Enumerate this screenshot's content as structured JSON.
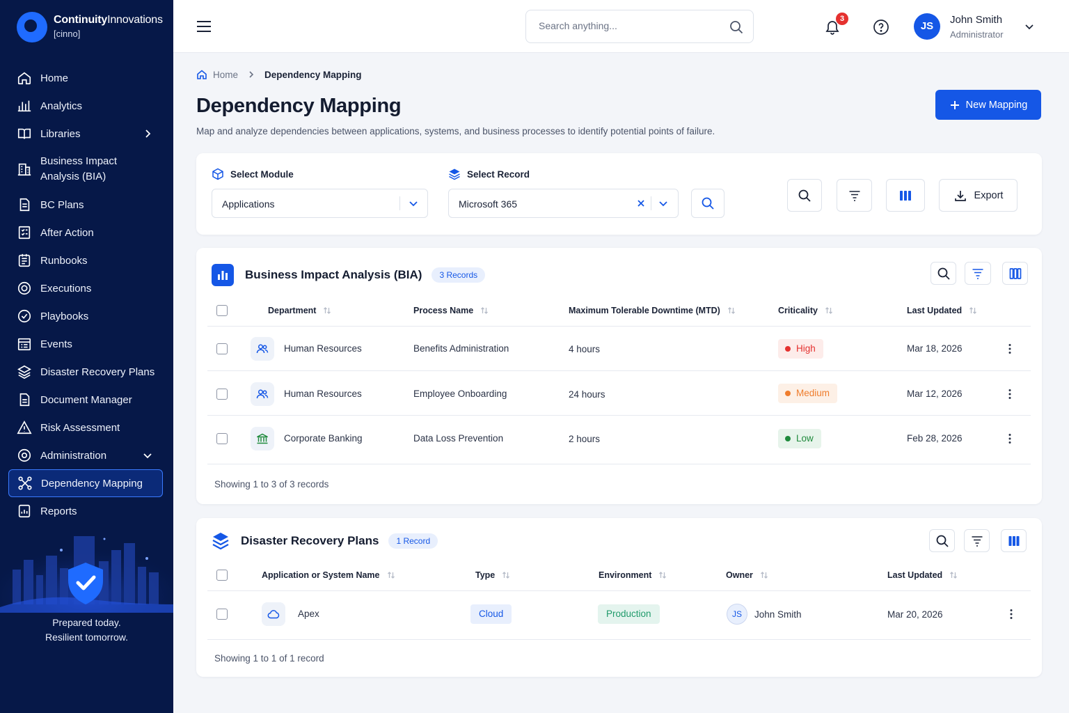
{
  "brand": {
    "name_bold": "Continuity",
    "name_light": "Innovations",
    "tag": "[cinno]"
  },
  "sidebar": {
    "items": [
      {
        "label": "Home",
        "icon": "home-icon"
      },
      {
        "label": "Analytics",
        "icon": "bar-chart-icon"
      },
      {
        "label": "Libraries",
        "icon": "book-icon"
      },
      {
        "label": "Business Impact Analysis (BIA)",
        "icon": "building-icon"
      },
      {
        "label": "BC Plans",
        "icon": "document-icon"
      },
      {
        "label": "After Action",
        "icon": "checklist-icon"
      },
      {
        "label": "Runbooks",
        "icon": "runbook-icon"
      },
      {
        "label": "Executions",
        "icon": "target-icon"
      },
      {
        "label": "Playbooks",
        "icon": "check-circle-icon"
      },
      {
        "label": "Events",
        "icon": "calendar-list-icon"
      },
      {
        "label": "Disaster Recovery Plans",
        "icon": "layers-icon"
      },
      {
        "label": "Document Manager",
        "icon": "file-icon"
      },
      {
        "label": "Risk Assessment",
        "icon": "warning-icon"
      },
      {
        "label": "Administration",
        "icon": "settings-icon"
      },
      {
        "label": "Dependency Mapping",
        "icon": "nodes-icon"
      },
      {
        "label": "Reports",
        "icon": "report-icon"
      }
    ],
    "tagline_1": "Prepared today.",
    "tagline_2": "Resilient tomorrow."
  },
  "header": {
    "search_placeholder": "Search anything...",
    "notif_count": "3",
    "user_initials": "JS",
    "user_name": "John Smith",
    "user_role": "Administrator"
  },
  "breadcrumb": {
    "home": "Home",
    "current": "Dependency Mapping"
  },
  "page": {
    "title": "Dependency Mapping",
    "subtitle": "Map and analyze dependencies between applications, systems, and business processes to identify potential points of failure.",
    "new_button": "New Mapping"
  },
  "filters": {
    "module_label": "Select Module",
    "module_value": "Applications",
    "record_label": "Select Record",
    "record_value": "Microsoft 365",
    "export_label": "Export"
  },
  "bia": {
    "title": "Business Impact Analysis (BIA)",
    "count": "3 Records",
    "columns": [
      "Department",
      "Process Name",
      "Maximum Tolerable Downtime (MTD)",
      "Criticality",
      "Last Updated"
    ],
    "rows": [
      {
        "department": "Human Resources",
        "icon": "users-icon",
        "process": "Benefits Administration",
        "mtd": "4 hours",
        "criticality": "High",
        "updated": "Mar 18, 2026"
      },
      {
        "department": "Human Resources",
        "icon": "users-icon",
        "process": "Employee Onboarding",
        "mtd": "24 hours",
        "criticality": "Medium",
        "updated": "Mar 12, 2026"
      },
      {
        "department": "Corporate Banking",
        "icon": "bank-icon",
        "process": "Data Loss Prevention",
        "mtd": "2 hours",
        "criticality": "Low",
        "updated": "Feb 28, 2026"
      }
    ],
    "showing": "Showing 1 to 3 of 3 records"
  },
  "drp": {
    "title": "Disaster Recovery Plans",
    "count": "1 Record",
    "columns": [
      "Application or System Name",
      "Type",
      "Environment",
      "Owner",
      "Last Updated"
    ],
    "rows": [
      {
        "name": "Apex",
        "icon": "cloud-icon",
        "type": "Cloud",
        "environment": "Production",
        "owner_initials": "JS",
        "owner": "John Smith",
        "updated": "Mar 20, 2026"
      }
    ],
    "showing": "Showing 1 to 1 of 1 record"
  },
  "colors": {
    "primary": "#1557e6",
    "sidebar": "#061848",
    "high": "#e5312f",
    "medium": "#ef7d2d",
    "low": "#1f8a3c"
  }
}
